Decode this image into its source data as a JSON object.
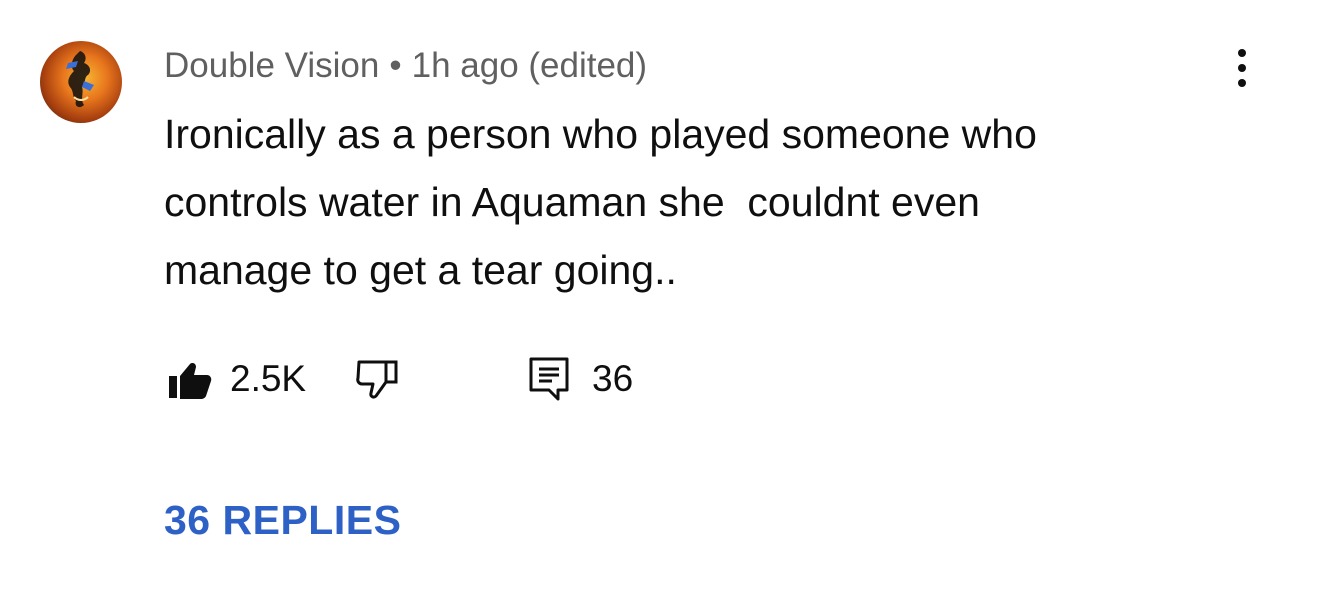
{
  "comment": {
    "author": "Double Vision",
    "separator": "•",
    "timestamp": "1h ago (edited)",
    "text": "Ironically as a person who played someone who\ncontrols water in Aquaman she  couldnt even\nmanage to get a tear going..",
    "likes": "2.5K",
    "reply_count": "36",
    "replies_link": "36 REPLIES"
  },
  "icons": {
    "avatar": "avatar-image",
    "more": "more-vertical-icon",
    "like": "thumbs-up-filled-icon",
    "dislike": "thumbs-down-outline-icon",
    "reply": "comment-reply-icon"
  },
  "colors": {
    "text": "#0f0f0f",
    "meta": "#606060",
    "link": "#2e61c6"
  }
}
